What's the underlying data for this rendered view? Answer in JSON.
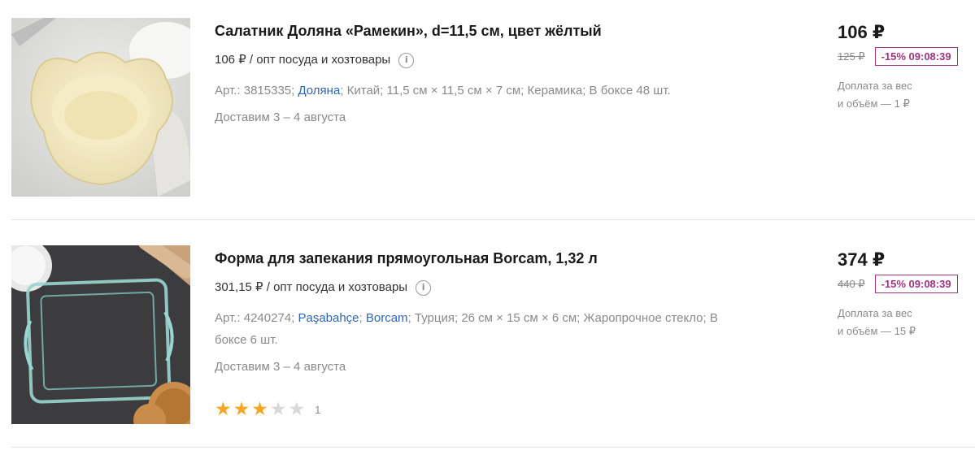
{
  "items": [
    {
      "title": "Салатник Доляна «Рамекин», d=11,5 см, цвет жёлтый",
      "unit_price": "106 ₽ / опт посуда и хозтовары",
      "article": "Арт.: 3815335; ",
      "brand1": "Доляна",
      "attrs_rest": "; Китай;  11,5 см × 11,5 см × 7 см;  Керамика;  В боксе 48 шт.",
      "delivery": "Доставим 3 – 4 августа",
      "price": "106 ₽",
      "old_price": "125 ₽",
      "discount": "-15% 09:08:39",
      "surcharge1": "Доплата за вес",
      "surcharge2": "и объём — 1 ₽"
    },
    {
      "title": "Форма для запекания прямоугольная Borcam, 1,32 л",
      "unit_price": "301,15 ₽ / опт посуда и хозтовары",
      "article": "Арт.: 4240274; ",
      "brand1": "Paşabahçe",
      "sep": "; ",
      "brand2": "Borcam",
      "attrs_rest": "; Турция;  26 см × 15 см × 6 см;  Жаропрочное стекло; В боксе 6 шт.",
      "delivery": "Доставим 3 – 4 августа",
      "rating_value": 3,
      "rating_max": 5,
      "rating_count": "1",
      "price": "374 ₽",
      "old_price": "440 ₽",
      "discount": "-15% 09:08:39",
      "surcharge1": "Доплата за вес",
      "surcharge2": "и объём — 15 ₽"
    }
  ],
  "icons": {
    "info": "info-circle-icon",
    "star": "star-icon"
  },
  "colors": {
    "link": "#2e67b0",
    "badge": "#a0347e",
    "star_on": "#f5a623",
    "star_off": "#d8d8d8"
  }
}
